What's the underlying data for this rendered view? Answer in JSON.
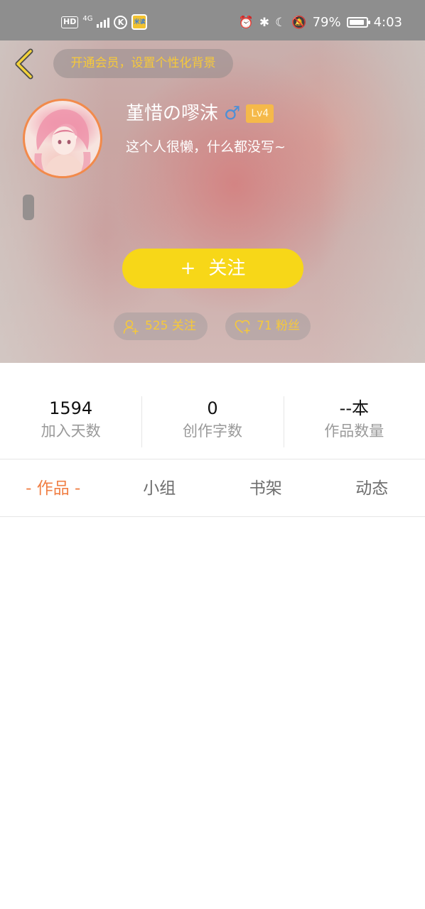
{
  "status_bar": {
    "hd": "HD",
    "network": "4G",
    "k_icon_text": "K",
    "app_icon_text": "米读",
    "battery": "79%",
    "time": "4:03",
    "icons": [
      "alarm-icon",
      "bluetooth-icon",
      "moon-icon",
      "mute-icon",
      "battery-icon"
    ]
  },
  "header": {
    "vip_banner": "开通会员，设置个性化背景",
    "username": "堇惜の嘐沫",
    "gender_icon": "♂",
    "level": "Lv4",
    "bio": "这个人很懒，什么都没写~",
    "follow_button": "关注",
    "follow_plus": "+",
    "following": "525 关注",
    "fans": "71 粉丝",
    "accent_color": "#f7d718",
    "pill_text_color": "#f6c93a"
  },
  "stats": [
    {
      "value": "1594",
      "label": "加入天数"
    },
    {
      "value": "0",
      "label": "创作字数"
    },
    {
      "value": "--本",
      "label": "作品数量"
    }
  ],
  "tabs": [
    {
      "label": "- 作品 -",
      "active": true
    },
    {
      "label": "小组",
      "active": false
    },
    {
      "label": "书架",
      "active": false
    },
    {
      "label": "动态",
      "active": false
    }
  ],
  "active_tab_color": "#f07f45"
}
